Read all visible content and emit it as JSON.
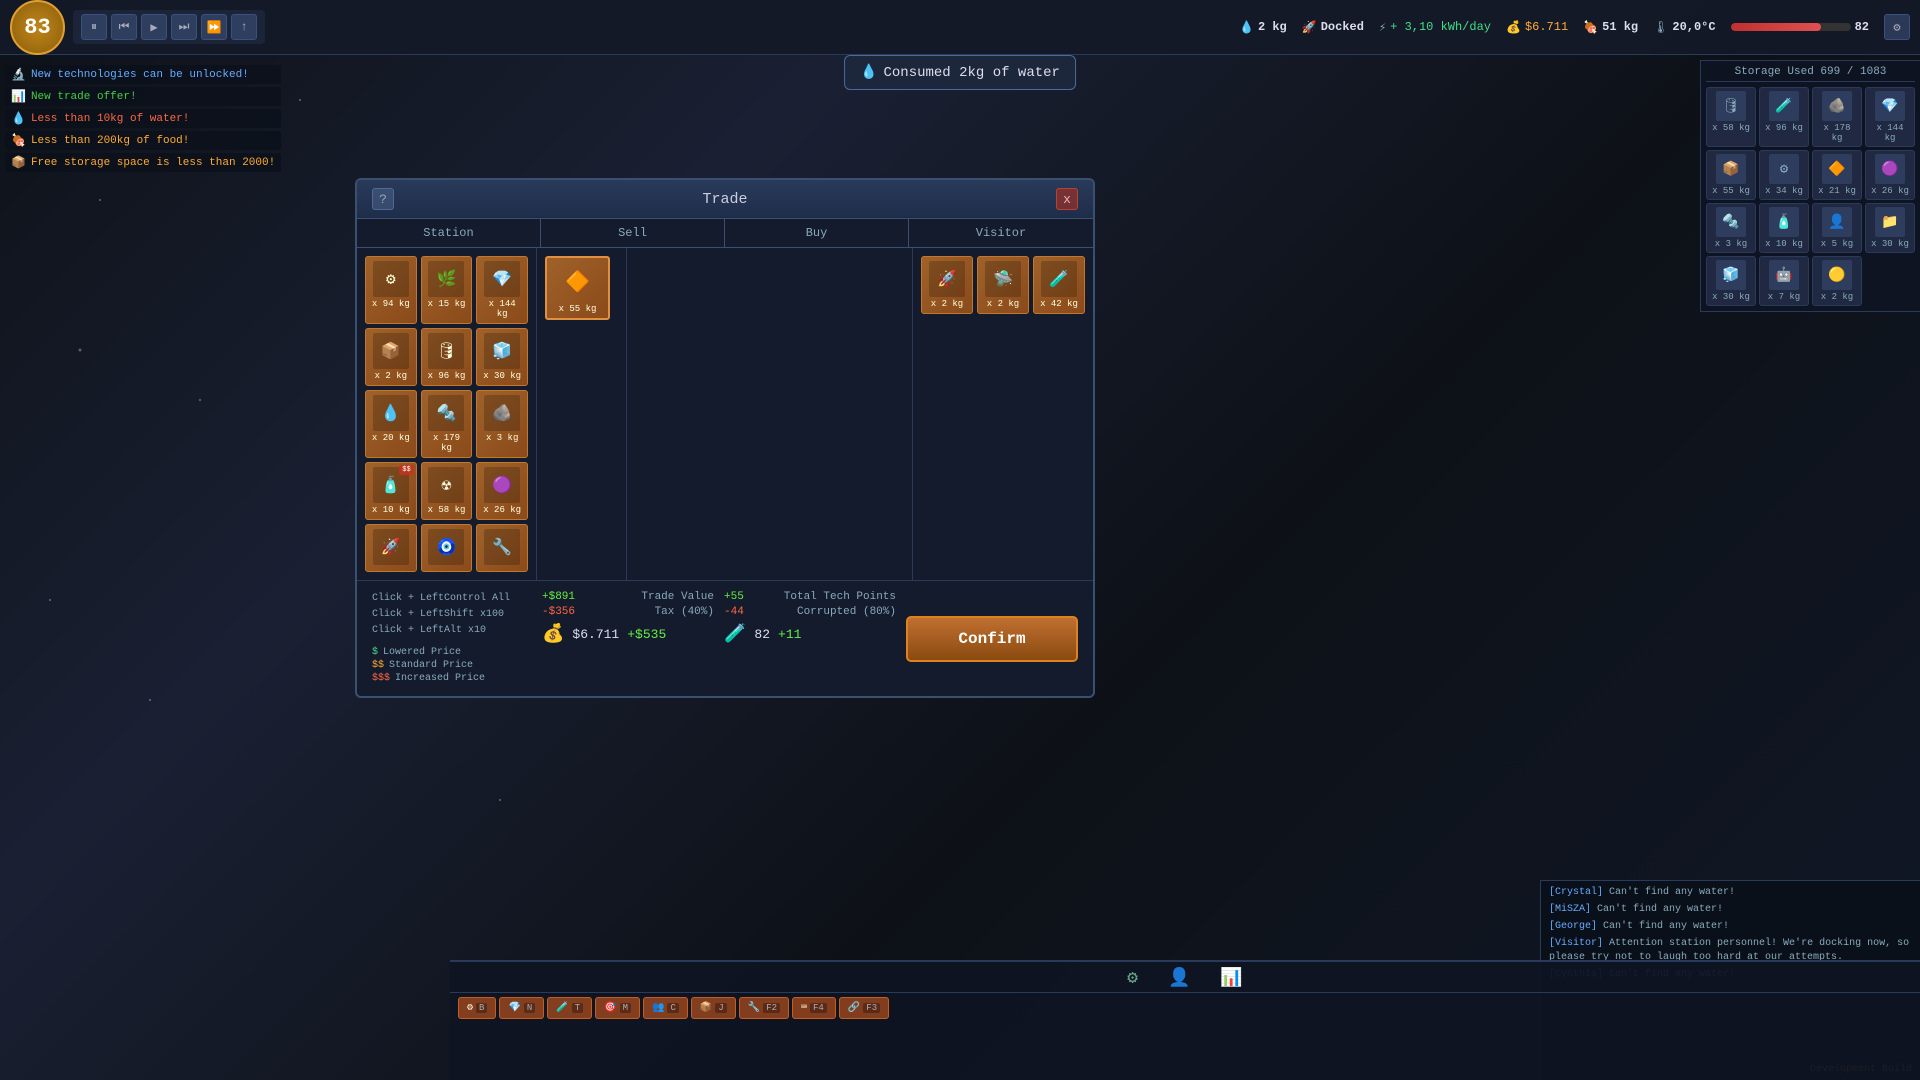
{
  "hud": {
    "day": "83",
    "controls": {
      "pause": "⏸",
      "step_back": "⏮",
      "play": "▶",
      "fast": "⏭",
      "fastest": "⏩"
    },
    "arrow_btn": "↑",
    "stats": {
      "water_kg": "2 kg",
      "water_icon": "💧",
      "status": "Docked",
      "energy_rate": "+ 3,10 kWh/day",
      "money": "$6.711",
      "food_kg": "51 kg",
      "temperature": "20,0°C",
      "hp_val": "82",
      "progress_pct": 75
    }
  },
  "notifications": [
    {
      "icon": "🔬",
      "text": "New technologies can be unlocked!",
      "type": "blue"
    },
    {
      "icon": "📊",
      "text": "New trade offer!",
      "type": "green"
    },
    {
      "icon": "💧",
      "text": "Less than 10kg of water!",
      "type": "red"
    },
    {
      "icon": "🍖",
      "text": "Less than 200kg of food!",
      "type": "yellow"
    },
    {
      "icon": "📦",
      "text": "Free storage space is less than 2000!",
      "type": "yellow"
    }
  ],
  "tooltip": "Consumed 2kg of water",
  "storage": {
    "title": "Storage Used 699 / 1083",
    "items": [
      {
        "icon": "🛢",
        "qty": "x 58 kg"
      },
      {
        "icon": "🧪",
        "qty": "x 96 kg"
      },
      {
        "icon": "🪨",
        "qty": "x 178 kg"
      },
      {
        "icon": "💎",
        "qty": "x 144 kg"
      },
      {
        "icon": "📦",
        "qty": "x 55 kg"
      },
      {
        "icon": "⚙",
        "qty": "x 34 kg"
      },
      {
        "icon": "🔶",
        "qty": "x 21 kg"
      },
      {
        "icon": "🟣",
        "qty": "x 26 kg"
      },
      {
        "icon": "🔩",
        "qty": "x 3 kg"
      },
      {
        "icon": "🧴",
        "qty": "x 10 kg"
      },
      {
        "icon": "👤",
        "qty": "x 5 kg"
      },
      {
        "icon": "📁",
        "qty": "x 30 kg"
      },
      {
        "icon": "🧊",
        "qty": "x 30 kg"
      },
      {
        "icon": "🤖",
        "qty": "x 7 kg"
      },
      {
        "icon": "🟡",
        "qty": "x 2 kg"
      }
    ]
  },
  "trade_modal": {
    "title": "Trade",
    "help_label": "?",
    "close_label": "x",
    "tabs": [
      "Station",
      "Sell",
      "Buy",
      "Visitor"
    ],
    "station_items": [
      {
        "icon": "⚙",
        "qty": "x 94 kg",
        "badge": ""
      },
      {
        "icon": "🌿",
        "qty": "x 15 kg",
        "badge": ""
      },
      {
        "icon": "💎",
        "qty": "x 144 kg",
        "badge": ""
      },
      {
        "icon": "📦",
        "qty": "x 2 kg",
        "badge": ""
      },
      {
        "icon": "🛢",
        "qty": "x 96 kg",
        "badge": ""
      },
      {
        "icon": "🧊",
        "qty": "x 30 kg",
        "badge": ""
      },
      {
        "icon": "💧",
        "qty": "x 20 kg",
        "badge": ""
      },
      {
        "icon": "🔩",
        "qty": "x 179 kg",
        "badge": ""
      },
      {
        "icon": "🪨",
        "qty": "x 3 kg",
        "badge": ""
      },
      {
        "icon": "🧴",
        "qty": "x 10 kg",
        "badge": ""
      },
      {
        "icon": "☢",
        "qty": "x 58 kg",
        "badge": "$$"
      },
      {
        "icon": "🟣",
        "qty": "x 26 kg",
        "badge": ""
      },
      {
        "icon": "🚀",
        "qty": "",
        "badge": ""
      },
      {
        "icon": "🧿",
        "qty": "",
        "badge": ""
      },
      {
        "icon": "🔧",
        "qty": "",
        "badge": ""
      }
    ],
    "sell_items": [
      {
        "icon": "🔶",
        "qty": "x 55 kg",
        "badge": ""
      }
    ],
    "visitor_items": [
      {
        "icon": "🚀",
        "qty": "x 2 kg",
        "badge": ""
      },
      {
        "icon": "🛸",
        "qty": "x 2 kg",
        "badge": ""
      },
      {
        "icon": "🧪",
        "qty": "x 42 kg",
        "badge": ""
      }
    ],
    "instructions": {
      "line1": "Click + LeftControl    All",
      "line2": "Click + LeftShift     x100",
      "line3": "Click + LeftAlt        x10"
    },
    "price_legend": {
      "low": "$    Lowered Price",
      "standard": "$$   Standard Price",
      "high": "$$$  Increased Price"
    },
    "trade_value": {
      "label": "Trade Value",
      "positive": "+$891",
      "tax_label": "Tax (40%)",
      "negative": "-$356",
      "total_current": "$6.711",
      "total_gain": "+$535"
    },
    "tech_points": {
      "label": "Total Tech Points",
      "positive": "+55",
      "corrupted_label": "Corrupted (80%)",
      "negative": "-44",
      "total_current": "82",
      "total_gain": "+11"
    },
    "confirm_label": "Confirm"
  },
  "chat": {
    "lines": [
      {
        "name": "[Crystal]",
        "text": " Can't find any water!"
      },
      {
        "name": "[MiSZA]",
        "text": " Can't find any water!"
      },
      {
        "name": "[George]",
        "text": " Can't find any water!"
      },
      {
        "name": "[Visitor]",
        "text": " Attention station personnel! We're docking now, so please try not to laugh too hard at our attempts."
      },
      {
        "name": "[Cynthia]",
        "text": " Can't find any water!"
      }
    ],
    "dev_build": "Development Build"
  },
  "bottom_hud": {
    "icons": [
      "⚙",
      "👤",
      "📊"
    ],
    "buttons": [
      {
        "icon": "⚙",
        "key": "B",
        "label": ""
      },
      {
        "icon": "💎",
        "key": "N",
        "label": ""
      },
      {
        "icon": "🧪",
        "key": "T",
        "label": ""
      },
      {
        "icon": "🎯",
        "key": "M",
        "label": ""
      },
      {
        "icon": "👥",
        "key": "C",
        "label": ""
      },
      {
        "icon": "📦",
        "key": "J",
        "label": ""
      },
      {
        "icon": "🔧",
        "key": "F2",
        "label": ""
      },
      {
        "icon": "⌨",
        "key": "F4",
        "label": ""
      },
      {
        "icon": "🔗",
        "key": "F3",
        "label": ""
      }
    ]
  }
}
